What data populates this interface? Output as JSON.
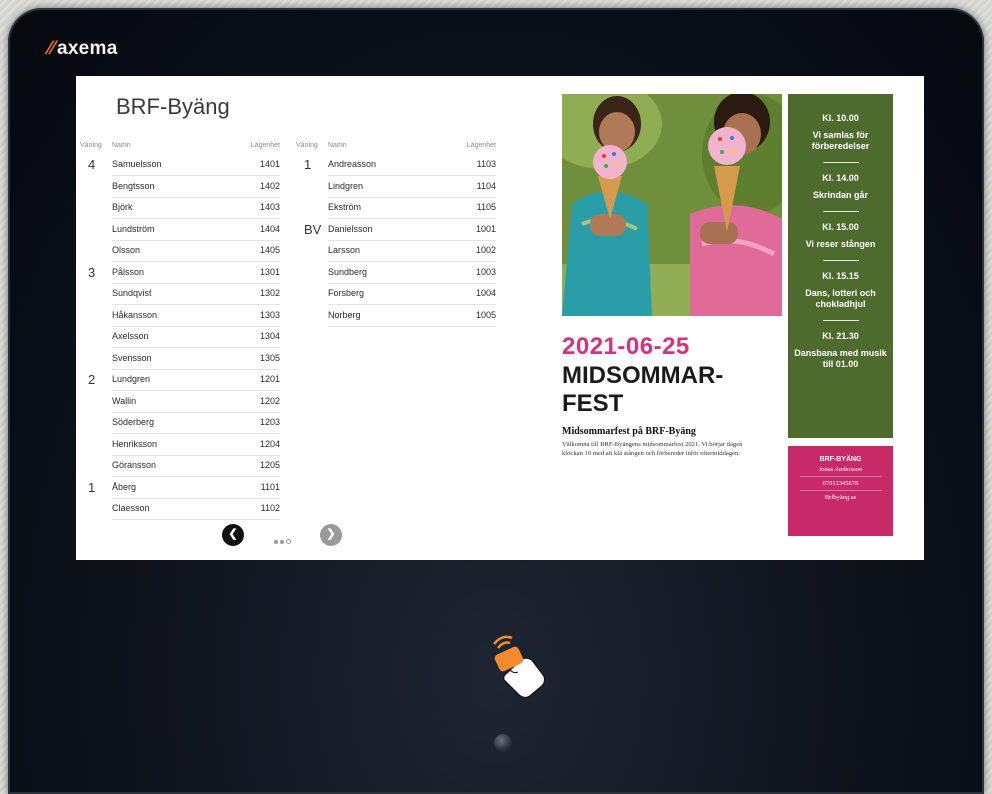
{
  "device": {
    "brand": "axema"
  },
  "board": {
    "title": "BRF-Byäng",
    "headers": {
      "floor": "Våning",
      "name": "Namn",
      "apartment": "Lägenhet"
    },
    "column_a": [
      {
        "floor": "4",
        "name": "Samuelsson",
        "apt": "1401"
      },
      {
        "floor": "",
        "name": "Bengtsson",
        "apt": "1402"
      },
      {
        "floor": "",
        "name": "Björk",
        "apt": "1403"
      },
      {
        "floor": "",
        "name": "Lundström",
        "apt": "1404"
      },
      {
        "floor": "",
        "name": "Olsson",
        "apt": "1405"
      },
      {
        "floor": "3",
        "name": "Pålsson",
        "apt": "1301"
      },
      {
        "floor": "",
        "name": "Sundqvist",
        "apt": "1302"
      },
      {
        "floor": "",
        "name": "Håkansson",
        "apt": "1303"
      },
      {
        "floor": "",
        "name": "Axelsson",
        "apt": "1304"
      },
      {
        "floor": "",
        "name": "Svensson",
        "apt": "1305"
      },
      {
        "floor": "2",
        "name": "Lundgren",
        "apt": "1201"
      },
      {
        "floor": "",
        "name": "Wallin",
        "apt": "1202"
      },
      {
        "floor": "",
        "name": "Söderberg",
        "apt": "1203"
      },
      {
        "floor": "",
        "name": "Henriksson",
        "apt": "1204"
      },
      {
        "floor": "",
        "name": "Göransson",
        "apt": "1205"
      },
      {
        "floor": "1",
        "name": "Åberg",
        "apt": "1101"
      },
      {
        "floor": "",
        "name": "Claesson",
        "apt": "1102"
      }
    ],
    "column_b": [
      {
        "floor": "1",
        "name": "Andreasson",
        "apt": "1103"
      },
      {
        "floor": "",
        "name": "Lindgren",
        "apt": "1104"
      },
      {
        "floor": "",
        "name": "Ekström",
        "apt": "1105"
      },
      {
        "floor": "BV",
        "name": "Danielsson",
        "apt": "1001"
      },
      {
        "floor": "",
        "name": "Larsson",
        "apt": "1002"
      },
      {
        "floor": "",
        "name": "Sundberg",
        "apt": "1003"
      },
      {
        "floor": "",
        "name": "Forsberg",
        "apt": "1004"
      },
      {
        "floor": "",
        "name": "Norberg",
        "apt": "1005"
      }
    ],
    "pagination": {
      "prev_icon": "chevron-left-icon",
      "next_icon": "chevron-right-icon",
      "pages": 3,
      "current": 1
    }
  },
  "event": {
    "date": "2021-06-25",
    "headline_1": "MIDSOMMAR-",
    "headline_2": "FEST",
    "subheading": "Midsommarfest på BRF-Byäng",
    "body": "Välkomna till BRF-Byängens midsommarfest 2021. Vi börjar dagen klockan 10 med att klä stången och förbereder inför eftermiddagen.",
    "schedule": [
      {
        "time": "Kl. 10.00",
        "text": "Vi samlas för förberedelser"
      },
      {
        "time": "Kl. 14.00",
        "text": "Skrindan går"
      },
      {
        "time": "Kl. 15.00",
        "text": "Vi reser stången"
      },
      {
        "time": "Kl. 15.15",
        "text": "Dans, lotteri och chokladhjul"
      },
      {
        "time": "Kl. 21.30",
        "text": "Dansbana med musik till 01.00"
      }
    ],
    "contact": {
      "org": "BRF-BYÄNG",
      "person": "Jonas Andersson",
      "phone": "07012345678",
      "web": "Brfbyäng.se"
    }
  },
  "colors": {
    "event_date": "#d8317a",
    "schedule_bg": "#4e6b2e",
    "contact_bg": "#c72a67",
    "brand_mark": "#f06b22"
  },
  "icons": {
    "nfc_reader": "nfc-tap-icon",
    "camera": "camera-sensor-icon"
  }
}
